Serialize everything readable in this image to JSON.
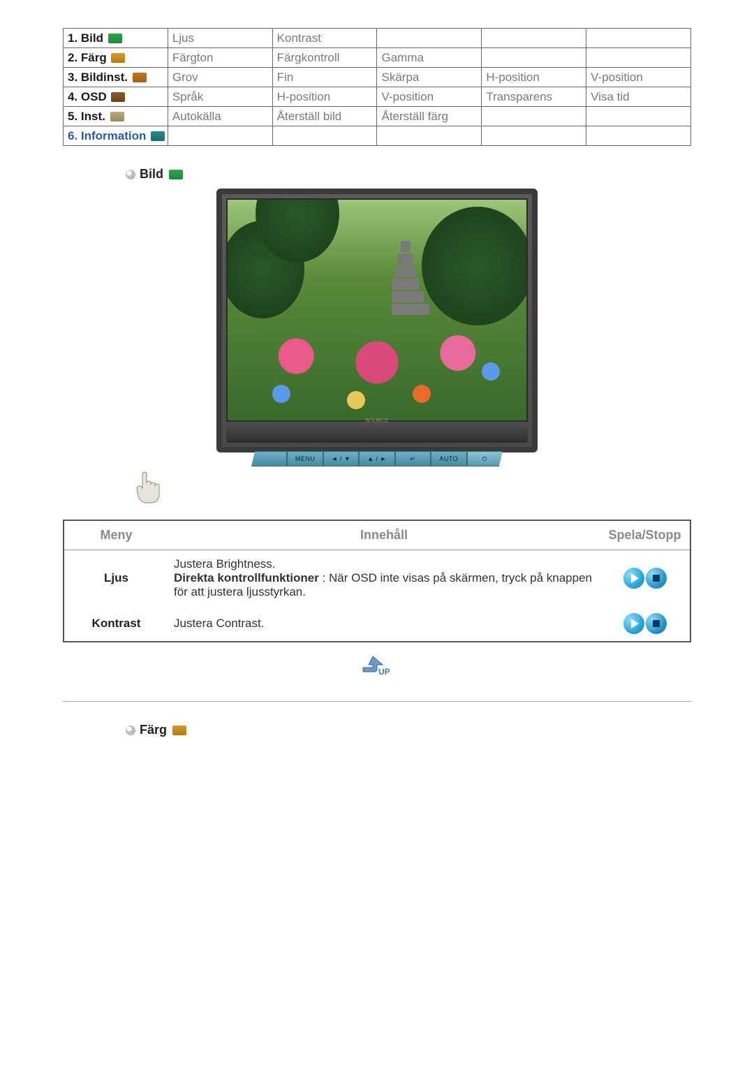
{
  "menu": {
    "rows": [
      {
        "label": "1. Bild",
        "icon": "icon-bild",
        "active": false,
        "cells": [
          "Ljus",
          "Kontrast",
          "",
          "",
          ""
        ]
      },
      {
        "label": "2. Färg",
        "icon": "icon-farg",
        "active": false,
        "cells": [
          "Färgton",
          "Färgkontroll",
          "Gamma",
          "",
          ""
        ]
      },
      {
        "label": "3. Bildinst.",
        "icon": "icon-bildinst",
        "active": false,
        "cells": [
          "Grov",
          "Fin",
          "Skärpa",
          "H-position",
          "V-position"
        ]
      },
      {
        "label": "4. OSD",
        "icon": "icon-osd",
        "active": false,
        "cells": [
          "Språk",
          "H-position",
          "V-position",
          "Transparens",
          "Visa tid"
        ]
      },
      {
        "label": "5. Inst.",
        "icon": "icon-inst",
        "active": false,
        "cells": [
          "Autokälla",
          "Återställ bild",
          "Återställ färg",
          "",
          ""
        ]
      },
      {
        "label": "6. Information",
        "icon": "icon-info",
        "active": true,
        "cells": [
          "",
          "",
          "",
          "",
          ""
        ]
      }
    ]
  },
  "sections": {
    "bild_title": "Bild",
    "farg_title": "Färg"
  },
  "monitor_buttons": [
    "",
    "MENU",
    "◄ / ▼",
    "▲ / ►",
    "↵",
    "AUTO",
    "⏻"
  ],
  "monitor_source_label": "SOURCE",
  "detail": {
    "headers": {
      "meny": "Meny",
      "innehall": "Innehåll",
      "spela": "Spela/Stopp"
    },
    "rows": [
      {
        "meny": "Ljus",
        "content_line1": "Justera Brightness.",
        "content_bold": "Direkta kontrollfunktioner",
        "content_rest": " : När OSD inte visas på skärmen, tryck på knappen för att justera ljusstyrkan."
      },
      {
        "meny": "Kontrast",
        "content_line1": "Justera Contrast.",
        "content_bold": "",
        "content_rest": ""
      }
    ]
  },
  "up_label": "UP"
}
